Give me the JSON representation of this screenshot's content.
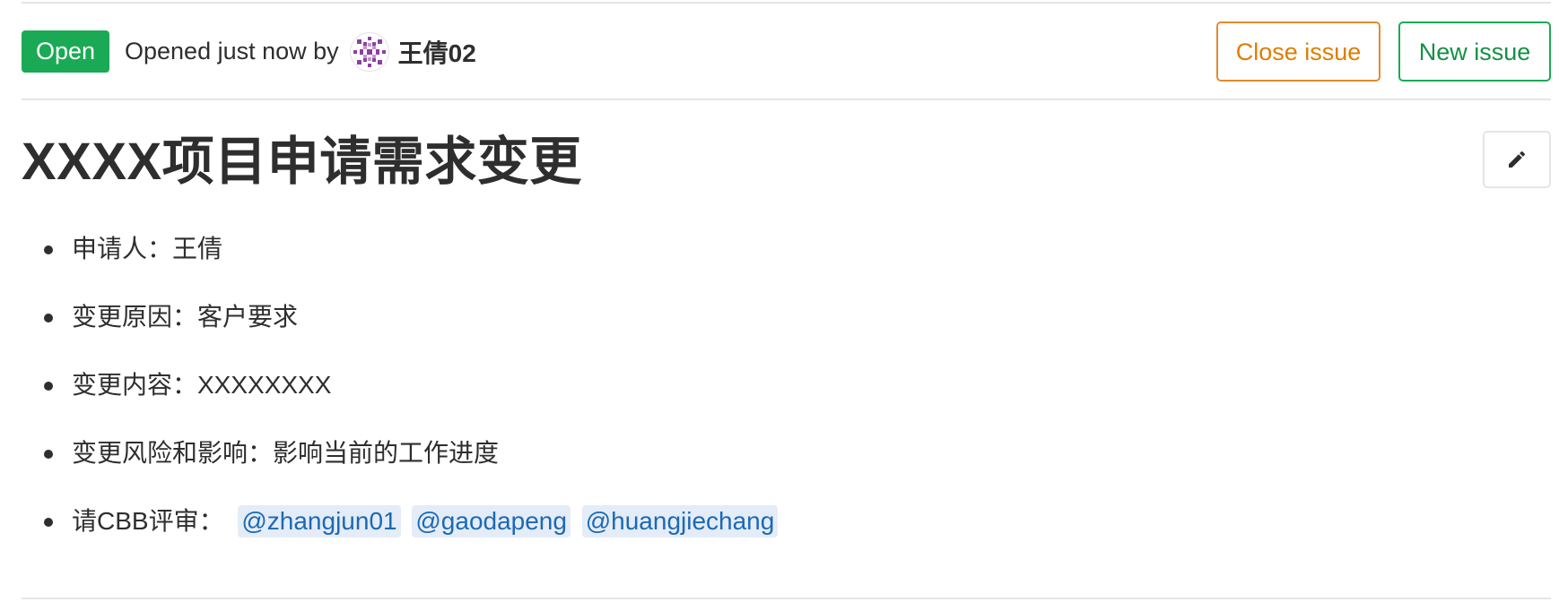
{
  "header": {
    "status": "Open",
    "opened_text": "Opened just now by",
    "author": "王倩02",
    "close_button": "Close issue",
    "new_button": "New issue"
  },
  "issue": {
    "title": "XXXX项目申请需求变更",
    "items": [
      {
        "text": "申请人：王倩"
      },
      {
        "text": "变更原因：客户要求"
      },
      {
        "text": "变更内容：XXXXXXXX"
      },
      {
        "text": "变更风险和影响：影响当前的工作进度"
      },
      {
        "text": "请CBB评审："
      }
    ],
    "mentions": [
      "@zhangjun01",
      "@gaodapeng",
      "@huangjiechang"
    ]
  },
  "colors": {
    "open_badge": "#1aaa55",
    "close_issue": "#de7e00",
    "new_issue": "#168f48",
    "mention_bg": "#e4ecf7",
    "mention_text": "#1b69b6"
  },
  "icons": {
    "avatar": "identicon-avatar",
    "edit": "pencil-icon"
  }
}
